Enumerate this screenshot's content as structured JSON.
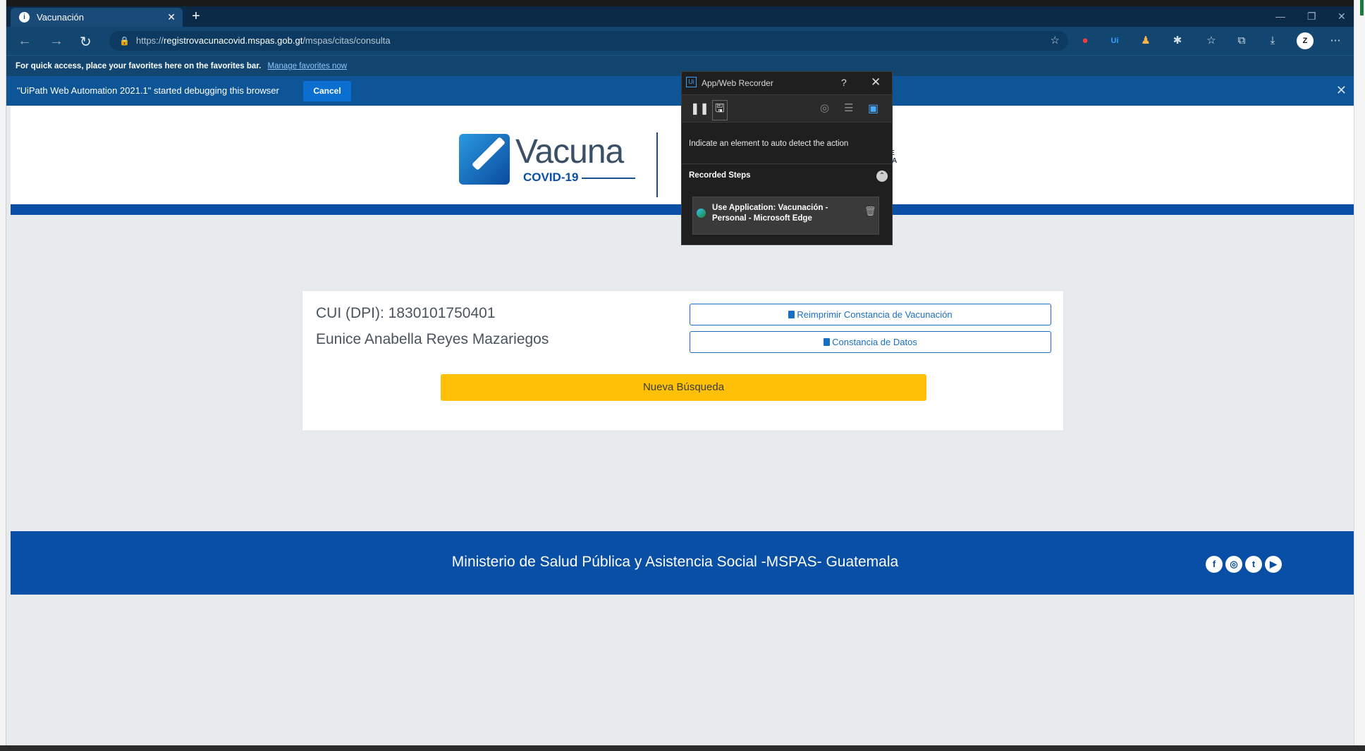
{
  "browser": {
    "tab_title": "Vacunación",
    "url_prefix": "https://",
    "url_host": "registrovacunacovid.mspas.gob.gt",
    "url_path": "/mspas/citas/consulta",
    "favorites_bar_text": "For quick access, place your favorites here on the favorites bar.",
    "favorites_bar_link": "Manage favorites now",
    "debug_text": "\"UiPath Web Automation 2021.1\" started debugging this browser",
    "debug_cancel": "Cancel"
  },
  "header": {
    "logo_word": "Vacuna",
    "logo_sub": "COVID-19",
    "partial_text": "DE\nICA\nA"
  },
  "card": {
    "cui": "CUI (DPI): 1830101750401",
    "name": "Eunice Anabella Reyes Mazariegos",
    "reprint_button": "Reimprimir Constancia de Vacunación",
    "data_button": "Constancia de Datos",
    "new_search_button": "Nueva Búsqueda"
  },
  "footer": {
    "text": "Ministerio de Salud Pública y Asistencia Social -MSPAS- Guatemala",
    "social": [
      "f",
      "◎",
      "t",
      "▶"
    ]
  },
  "recorder": {
    "title": "App/Web Recorder",
    "help": "?",
    "hint": "Indicate an element to auto detect the action",
    "steps_label": "Recorded Steps",
    "step1": "Use Application: Vacunación - Personal - Microsoft Edge"
  },
  "colors": {
    "brand_blue": "#0a4fa6",
    "yellow_button": "#ffc107",
    "titlebar": "#0b2a47"
  }
}
